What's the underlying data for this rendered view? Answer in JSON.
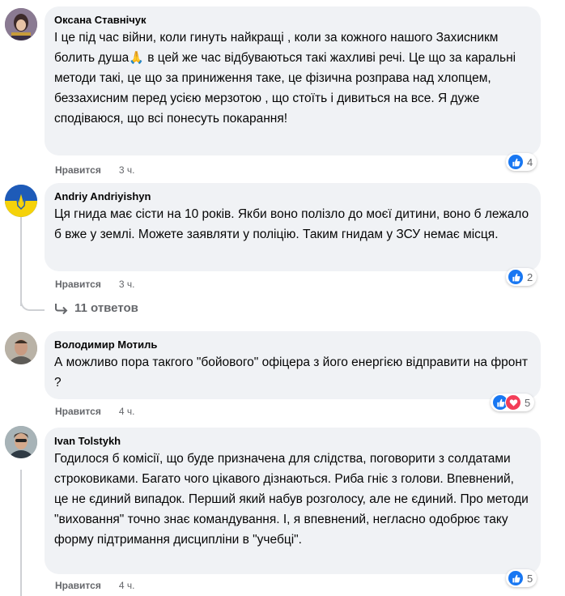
{
  "comments": [
    {
      "author": "Оксана Ставнічук",
      "text_parts": [
        "І це під час війни, коли гинуть найкращі , коли за кожного нашого Захисникм болить душа",
        "🙏",
        " в цей же час відбуваються такі жахливі речі. Це що за каральні методи такі, це що за приниження таке, це фізична розправа над хлопцем, беззахисним перед усією мерзотою , що стоїть і дивиться на все. Я дуже сподіваюся, що всі понесуть покарання!"
      ],
      "like_label": "Нравится",
      "time": "3 ч.",
      "reaction_count": "4"
    },
    {
      "author": "Andriy Andriyishyn",
      "text": "Ця гнида має сісти на 10 років. Якби воно полізло до моєї дитини, воно б лежало б вже у землі. Можете заявляти у поліцію. Таким гнидам у ЗСУ немає місця.",
      "like_label": "Нравится",
      "time": "3 ч.",
      "reaction_count": "2",
      "replies_label": "11 ответов"
    },
    {
      "author": "Володимир Мотиль",
      "text": "А можливо пора такгого \"бойового\" офіцера з його енергією відправити на фронт ?",
      "like_label": "Нравится",
      "time": "4 ч.",
      "reaction_count": "5"
    },
    {
      "author": "Ivan Tolstykh",
      "text": "Годилося б комісії, що буде призначена для слідства, поговорити з солдатами строковиками. Багато чого цікавого дізнаються. Риба гніє з голови. Впевнений, це не єдиний випадок. Перший який набув розголосу, але не єдиний. Про методи \"виховання\" точно знає командування. І, я впевнений, негласно одобрює таку форму підтримання дисципліни в \"учебці\".",
      "like_label": "Нравится",
      "time": "4 ч.",
      "reaction_count": "5"
    }
  ],
  "colors": {
    "like": "#1877f2",
    "love": "#f33e58",
    "bubble": "#f0f2f5",
    "meta": "#65676b"
  }
}
